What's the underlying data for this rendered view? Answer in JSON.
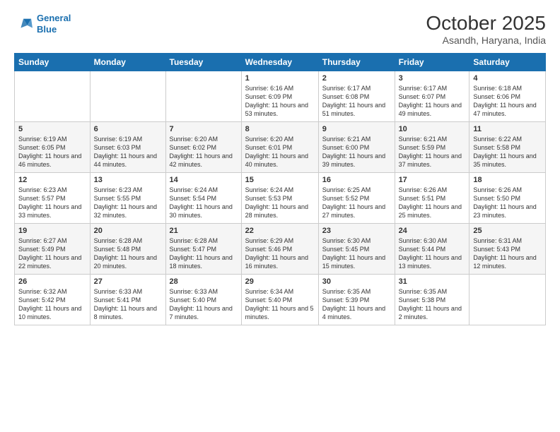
{
  "header": {
    "logo_line1": "General",
    "logo_line2": "Blue",
    "month": "October 2025",
    "location": "Asandh, Haryana, India"
  },
  "days_of_week": [
    "Sunday",
    "Monday",
    "Tuesday",
    "Wednesday",
    "Thursday",
    "Friday",
    "Saturday"
  ],
  "weeks": [
    [
      {
        "day": "",
        "text": ""
      },
      {
        "day": "",
        "text": ""
      },
      {
        "day": "",
        "text": ""
      },
      {
        "day": "1",
        "text": "Sunrise: 6:16 AM\nSunset: 6:09 PM\nDaylight: 11 hours and 53 minutes."
      },
      {
        "day": "2",
        "text": "Sunrise: 6:17 AM\nSunset: 6:08 PM\nDaylight: 11 hours and 51 minutes."
      },
      {
        "day": "3",
        "text": "Sunrise: 6:17 AM\nSunset: 6:07 PM\nDaylight: 11 hours and 49 minutes."
      },
      {
        "day": "4",
        "text": "Sunrise: 6:18 AM\nSunset: 6:06 PM\nDaylight: 11 hours and 47 minutes."
      }
    ],
    [
      {
        "day": "5",
        "text": "Sunrise: 6:19 AM\nSunset: 6:05 PM\nDaylight: 11 hours and 46 minutes."
      },
      {
        "day": "6",
        "text": "Sunrise: 6:19 AM\nSunset: 6:03 PM\nDaylight: 11 hours and 44 minutes."
      },
      {
        "day": "7",
        "text": "Sunrise: 6:20 AM\nSunset: 6:02 PM\nDaylight: 11 hours and 42 minutes."
      },
      {
        "day": "8",
        "text": "Sunrise: 6:20 AM\nSunset: 6:01 PM\nDaylight: 11 hours and 40 minutes."
      },
      {
        "day": "9",
        "text": "Sunrise: 6:21 AM\nSunset: 6:00 PM\nDaylight: 11 hours and 39 minutes."
      },
      {
        "day": "10",
        "text": "Sunrise: 6:21 AM\nSunset: 5:59 PM\nDaylight: 11 hours and 37 minutes."
      },
      {
        "day": "11",
        "text": "Sunrise: 6:22 AM\nSunset: 5:58 PM\nDaylight: 11 hours and 35 minutes."
      }
    ],
    [
      {
        "day": "12",
        "text": "Sunrise: 6:23 AM\nSunset: 5:57 PM\nDaylight: 11 hours and 33 minutes."
      },
      {
        "day": "13",
        "text": "Sunrise: 6:23 AM\nSunset: 5:55 PM\nDaylight: 11 hours and 32 minutes."
      },
      {
        "day": "14",
        "text": "Sunrise: 6:24 AM\nSunset: 5:54 PM\nDaylight: 11 hours and 30 minutes."
      },
      {
        "day": "15",
        "text": "Sunrise: 6:24 AM\nSunset: 5:53 PM\nDaylight: 11 hours and 28 minutes."
      },
      {
        "day": "16",
        "text": "Sunrise: 6:25 AM\nSunset: 5:52 PM\nDaylight: 11 hours and 27 minutes."
      },
      {
        "day": "17",
        "text": "Sunrise: 6:26 AM\nSunset: 5:51 PM\nDaylight: 11 hours and 25 minutes."
      },
      {
        "day": "18",
        "text": "Sunrise: 6:26 AM\nSunset: 5:50 PM\nDaylight: 11 hours and 23 minutes."
      }
    ],
    [
      {
        "day": "19",
        "text": "Sunrise: 6:27 AM\nSunset: 5:49 PM\nDaylight: 11 hours and 22 minutes."
      },
      {
        "day": "20",
        "text": "Sunrise: 6:28 AM\nSunset: 5:48 PM\nDaylight: 11 hours and 20 minutes."
      },
      {
        "day": "21",
        "text": "Sunrise: 6:28 AM\nSunset: 5:47 PM\nDaylight: 11 hours and 18 minutes."
      },
      {
        "day": "22",
        "text": "Sunrise: 6:29 AM\nSunset: 5:46 PM\nDaylight: 11 hours and 16 minutes."
      },
      {
        "day": "23",
        "text": "Sunrise: 6:30 AM\nSunset: 5:45 PM\nDaylight: 11 hours and 15 minutes."
      },
      {
        "day": "24",
        "text": "Sunrise: 6:30 AM\nSunset: 5:44 PM\nDaylight: 11 hours and 13 minutes."
      },
      {
        "day": "25",
        "text": "Sunrise: 6:31 AM\nSunset: 5:43 PM\nDaylight: 11 hours and 12 minutes."
      }
    ],
    [
      {
        "day": "26",
        "text": "Sunrise: 6:32 AM\nSunset: 5:42 PM\nDaylight: 11 hours and 10 minutes."
      },
      {
        "day": "27",
        "text": "Sunrise: 6:33 AM\nSunset: 5:41 PM\nDaylight: 11 hours and 8 minutes."
      },
      {
        "day": "28",
        "text": "Sunrise: 6:33 AM\nSunset: 5:40 PM\nDaylight: 11 hours and 7 minutes."
      },
      {
        "day": "29",
        "text": "Sunrise: 6:34 AM\nSunset: 5:40 PM\nDaylight: 11 hours and 5 minutes."
      },
      {
        "day": "30",
        "text": "Sunrise: 6:35 AM\nSunset: 5:39 PM\nDaylight: 11 hours and 4 minutes."
      },
      {
        "day": "31",
        "text": "Sunrise: 6:35 AM\nSunset: 5:38 PM\nDaylight: 11 hours and 2 minutes."
      },
      {
        "day": "",
        "text": ""
      }
    ]
  ]
}
